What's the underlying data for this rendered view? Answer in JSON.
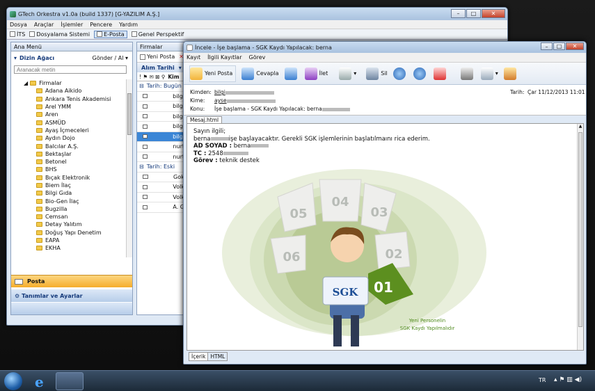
{
  "main_window": {
    "title": "GTech Orkestra v1.0a (build 1337) [G-YAZILIM A.Ş.]",
    "menu": [
      "Dosya",
      "Araçlar",
      "İşlemler",
      "Pencere",
      "Yardım"
    ],
    "perspectives": [
      "İTS",
      "Dosyalama Sistemi",
      "E-Posta",
      "Genel Perspektif"
    ],
    "active_perspective": "E-Posta",
    "left_panel": {
      "header": "Ana Menü",
      "tree_title": "Dizin Ağacı",
      "send_receive": "Gönder / Al",
      "search_placeholder": "Aranacak metin",
      "root": "Firmalar",
      "items": [
        "Adana Aikido",
        "Ankara Tenis Akademisi",
        "Arel YMM",
        "Aren",
        "ASMÜD",
        "Ayaş İçmeceleri",
        "Aydın Dojo",
        "Balcılar A.Ş.",
        "Bektaşlar",
        "Betonel",
        "BHS",
        "Bıçak Elektronik",
        "Biem İlaç",
        "Bilgi Gıda",
        "Bio-Gen İlaç",
        "Bugzilla",
        "Cemsan",
        "Detay Yalıtım",
        "Doğuş Yapı Denetim",
        "EAPA",
        "EKHA"
      ],
      "nav_posta": "Posta",
      "nav_settings": "Tanımlar ve Ayarlar"
    },
    "mid_panel": {
      "header": "Firmalar",
      "new_mail": "Yeni Posta",
      "sort": "Alım Tarihi",
      "col": "Kim",
      "group_today": "Tarih: Bugün",
      "group_old": "Tarih: Eski",
      "rows_today": [
        "bilgi",
        "bilgi",
        "bilgi",
        "bilgi",
        "bilgi",
        "nurt",
        "nurt"
      ],
      "rows_old": [
        "Gok",
        "Volk",
        "Volk",
        "A. G"
      ]
    }
  },
  "inspect_window": {
    "title": "İncele - İşe başlama - SGK Kaydı Yapılacak: berna",
    "menu": [
      "Kayıt",
      "İlgili Kayıtlar",
      "Görev"
    ],
    "toolbar": {
      "new": "Yeni Posta",
      "reply": "Cevapla",
      "forward": "İlet",
      "delete": "Sil"
    },
    "from_label": "Kimden:",
    "from": "bilgi",
    "to_label": "Kime:",
    "to": "ayse",
    "subject_label": "Konu:",
    "subject": "İşe başlama - SGK Kaydı Yapılacak: berna",
    "date_label": "Tarih:",
    "date": "Çar 11/12/2013 11:01",
    "tab": "Mesaj.html",
    "greeting": "Sayın ilgili;",
    "line1_name": "berna",
    "line1": "işe başlayacaktır. Gerekli SGK işlemlerinin başlatılmaını rica ederim.",
    "adsoyad_label": "AD SOYAD :",
    "adsoyad": "berna",
    "tc_label": "TC :",
    "tc": "2548",
    "gorev_label": "Görev :",
    "gorev": "teknik destek",
    "illustration": {
      "numbers": [
        "05",
        "04",
        "03",
        "06",
        "02",
        "01"
      ],
      "badge": "SGK",
      "caption1": "Yeni Personelin",
      "caption2": "SGK Kaydı Yapılmalıdır"
    },
    "bottom_tabs": [
      "İçerik",
      "HTML"
    ]
  },
  "taskbar": {
    "lang": "TR"
  }
}
